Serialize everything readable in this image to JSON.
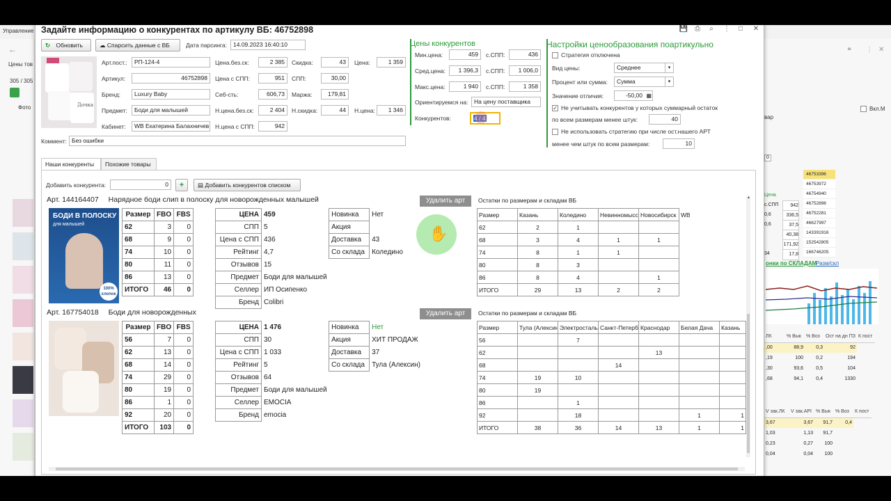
{
  "background": {
    "app_tab": "Управление",
    "left_panel_title": "Цены тов",
    "left_counter": "305 / 305",
    "left_col": "Фото",
    "right_checkbox_label": "Вкл.М",
    "right_text": "вар",
    "right_num": "0",
    "right_articles": [
      "46753396",
      "46753972",
      "46754940",
      "46752898",
      "46752281",
      "46627997",
      "143391916",
      "152542805",
      "166746205"
    ],
    "right_rows1": [
      [
        "Цена",
        ""
      ],
      [
        "с.СПП",
        "942"
      ],
      [
        "0,6",
        "336,5"
      ],
      [
        "0,6",
        "37,5"
      ],
      [
        "",
        "40,38"
      ],
      [
        "",
        "171,92"
      ],
      [
        "34",
        "17,8"
      ]
    ],
    "right_tab1": "онки по СКЛАДАМ",
    "right_tab2": "Разм/скл",
    "right_tbl1_head": [
      "ЛК",
      "% Вык",
      "% Воз",
      "Ост на дн ПЗ",
      "К пост"
    ],
    "right_tbl1_rows": [
      [
        ",00",
        "88,9",
        "0,3",
        "92"
      ],
      [
        ",19",
        "100",
        "0,2",
        "194"
      ],
      [
        ",30",
        "93,6",
        "0,5",
        "104"
      ],
      [
        ",68",
        "94,1",
        "0,4",
        "1330"
      ]
    ],
    "right_tbl2_head": [
      "V зак.ЛК",
      "V зак.API",
      "% Вык",
      "% Воз",
      "К пост"
    ],
    "right_tbl2_rows": [
      [
        "3,67",
        "3,67",
        "91,7",
        "0,4"
      ],
      [
        "1,03",
        "1,13",
        "91,7",
        ""
      ],
      [
        "0,23",
        "0,27",
        "100",
        ""
      ],
      [
        "0,04",
        "0,04",
        "100",
        ""
      ]
    ]
  },
  "dialog": {
    "title": "Задайте информацию о конкурентах по артикулу ВБ: 46752898",
    "refresh_button": "Обновить",
    "parse_button": "Спарсить данные с ВБ",
    "parse_date_label": "Дата парсинга:",
    "parse_date": "14.09.2023 16:40:10",
    "product": {
      "art_post_label": "Арт.пост.:",
      "art_post": "РП-124-4",
      "article_label": "Артикул:",
      "article": "46752898",
      "brand_label": "Бренд:",
      "brand": "Luxury Baby",
      "subject_label": "Предмет:",
      "subject": "Боди для малышей",
      "cabinet_label": "Кабинет:",
      "cabinet": "WB Екатерина Балахничев",
      "price_noskid_label": "Цена.без.ск:",
      "price_noskid": "2 385",
      "price_spp_label": "Цена с СПП:",
      "price_spp": "951",
      "cost_label": "Себ-сть:",
      "cost": "606,73",
      "nprice_noskid_label": "Н.цена.без.ск:",
      "nprice_noskid": "2 404",
      "nprice_spp_label": "Н.цена с СПП:",
      "nprice_spp": "942",
      "discount_label": "Скидка:",
      "discount": "43",
      "spp_label": "СПП:",
      "spp": "30,00",
      "margin_label": "Маржа:",
      "margin": "179,81",
      "ndiscount_label": "Н.скидка:",
      "ndiscount": "44",
      "price_label": "Цена:",
      "price": "1 359",
      "nprice_label": "Н.цена:",
      "nprice": "1 346"
    },
    "comment_label": "Коммент:",
    "comment": "Без ошибки",
    "competitor_prices": {
      "title": "Цены конкурентов",
      "min_label": "Мин.цена:",
      "min": "459",
      "min_spp_label": "с.СПП:",
      "min_spp": "436",
      "avg_label": "Сред.цена:",
      "avg": "1 396,3",
      "avg_spp_label": "с.СПП:",
      "avg_spp": "1 006,0",
      "max_label": "Макс.цена:",
      "max": "1 940",
      "max_spp_label": "с.СПП:",
      "max_spp": "1 358",
      "orient_label": "Ориентируемся на:",
      "orient": "На цену поставщика",
      "count_label": "Конкурентов:",
      "count": "4 / 4"
    },
    "pricing": {
      "title": "Настройки ценообразования поартикульно",
      "strategy_off": "Стратегия отключена",
      "price_type_label": "Вид цены:",
      "price_type": "Среднее",
      "percent_label": "Процент или сумма:",
      "percent": "Сумма",
      "diff_label": "Значение отличия:",
      "diff": "-50,00",
      "ignore_label": "Не учитывать конкурентов у которых суммарный остаток",
      "ignore_label2": "по всем размерам менее штук:",
      "ignore_value": "40",
      "nouse_label": "Не использовать стратегию при числе ост.нашего АРТ",
      "nouse_label2": "менее чем штук по всем размерам:",
      "nouse_value": "10"
    },
    "tabs": [
      "Наши конкуренты",
      "Похожие товары"
    ],
    "add_competitor_label": "Добавить конкурента:",
    "add_competitor_value": "0",
    "add_list_button": "Добавить конкурентов списком",
    "plus": "+"
  },
  "competitors": [
    {
      "art_label": "Арт.",
      "art": "144164407",
      "name": "Нарядное боди слип в полоску для новорожденных малышей",
      "delete": "Удалить арт",
      "photo_text1": "БОДИ В ПОЛОСКУ",
      "photo_text2": "для малышей",
      "photo_text3": "100% хлопок",
      "size_head": [
        "Размер",
        "FBO",
        "FBS"
      ],
      "sizes": [
        [
          "62",
          "3",
          "0"
        ],
        [
          "68",
          "9",
          "0"
        ],
        [
          "74",
          "10",
          "0"
        ],
        [
          "80",
          "11",
          "0"
        ],
        [
          "86",
          "13",
          "0"
        ],
        [
          "ИТОГО",
          "46",
          "0"
        ]
      ],
      "info_left": [
        [
          "ЦЕНА",
          "459"
        ],
        [
          "СПП",
          "5"
        ],
        [
          "Цена с СПП",
          "436"
        ],
        [
          "Рейтинг",
          "4,7"
        ],
        [
          "Отзывов",
          "15"
        ],
        [
          "Предмет",
          "Боди для малышей"
        ],
        [
          "Селлер",
          "ИП Осипенко"
        ],
        [
          "Бренд",
          "Colibri"
        ]
      ],
      "info_right": [
        [
          "Новинка",
          "Нет"
        ],
        [
          "Акция",
          ""
        ],
        [
          "Доставка",
          "43"
        ],
        [
          "Со склада",
          "Коледино"
        ]
      ],
      "stock_title": "Остатки по размерам и складам ВБ",
      "stock_head": [
        "Размер",
        "Казань",
        "Коледино",
        "Невинномысс",
        "Новосибирск",
        "WB"
      ],
      "stock_rows": [
        [
          "62",
          "2",
          "1",
          "",
          "",
          ""
        ],
        [
          "68",
          "3",
          "4",
          "1",
          "1",
          ""
        ],
        [
          "74",
          "8",
          "1",
          "1",
          "",
          ""
        ],
        [
          "80",
          "8",
          "3",
          "",
          "",
          ""
        ],
        [
          "86",
          "8",
          "4",
          "",
          "1",
          ""
        ],
        [
          "ИТОГО",
          "29",
          "13",
          "2",
          "2",
          ""
        ]
      ]
    },
    {
      "art_label": "Арт.",
      "art": "167754018",
      "name": "Боди для новорожденных",
      "delete": "Удалить арт",
      "photo_text1": "",
      "photo_text2": "",
      "photo_text3": "",
      "size_head": [
        "Размер",
        "FBO",
        "FBS"
      ],
      "sizes": [
        [
          "56",
          "7",
          "0"
        ],
        [
          "62",
          "13",
          "0"
        ],
        [
          "68",
          "14",
          "0"
        ],
        [
          "74",
          "29",
          "0"
        ],
        [
          "80",
          "19",
          "0"
        ],
        [
          "86",
          "1",
          "0"
        ],
        [
          "92",
          "20",
          "0"
        ],
        [
          "ИТОГО",
          "103",
          "0"
        ]
      ],
      "info_left": [
        [
          "ЦЕНА",
          "1 476"
        ],
        [
          "СПП",
          "30"
        ],
        [
          "Цена с СПП",
          "1 033"
        ],
        [
          "Рейтинг",
          "5"
        ],
        [
          "Отзывов",
          "64"
        ],
        [
          "Предмет",
          "Боди для малышей"
        ],
        [
          "Селлер",
          "EMOCIA"
        ],
        [
          "Бренд",
          "emocia"
        ]
      ],
      "info_right": [
        [
          "Новинка",
          "Нет"
        ],
        [
          "Акция",
          "ХИТ ПРОДАЖ"
        ],
        [
          "Доставка",
          "37"
        ],
        [
          "Со склада",
          "Тула (Алексин)"
        ]
      ],
      "stock_title": "Остатки по размерам и складам ВБ",
      "stock_head": [
        "Размер",
        "Тула (Алексин",
        "Электросталь",
        "Санкт-Петерб",
        "Краснодар",
        "Белая Дача",
        "Казань"
      ],
      "stock_rows": [
        [
          "56",
          "",
          "7",
          "",
          "",
          "",
          ""
        ],
        [
          "62",
          "",
          "",
          "",
          "13",
          "",
          ""
        ],
        [
          "68",
          "",
          "",
          "14",
          "",
          "",
          ""
        ],
        [
          "74",
          "19",
          "10",
          "",
          "",
          "",
          ""
        ],
        [
          "80",
          "19",
          "",
          "",
          "",
          "",
          ""
        ],
        [
          "86",
          "",
          "1",
          "",
          "",
          "",
          ""
        ],
        [
          "92",
          "",
          "18",
          "",
          "",
          "1",
          "1"
        ],
        [
          "ИТОГО",
          "38",
          "36",
          "14",
          "13",
          "1",
          "1"
        ]
      ]
    }
  ],
  "colors": {
    "accent_green": "#2a9a3a",
    "delete_btn": "#8e8e8e",
    "cursor_highlight": "#a8e6a3"
  }
}
